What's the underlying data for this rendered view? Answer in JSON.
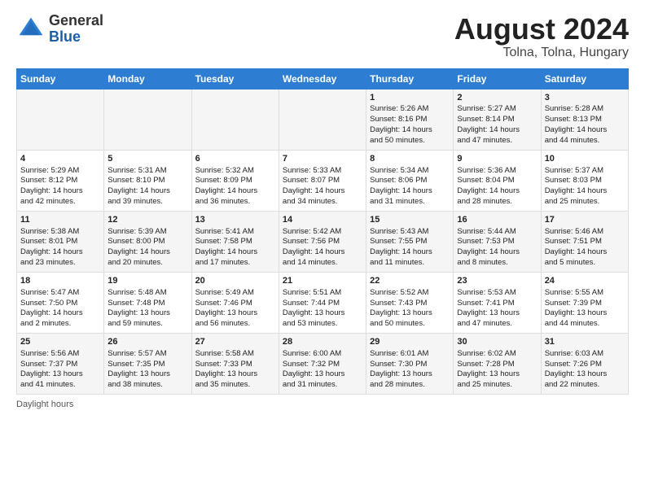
{
  "header": {
    "logo_general": "General",
    "logo_blue": "Blue",
    "title": "August 2024",
    "subtitle": "Tolna, Tolna, Hungary"
  },
  "days_of_week": [
    "Sunday",
    "Monday",
    "Tuesday",
    "Wednesday",
    "Thursday",
    "Friday",
    "Saturday"
  ],
  "footer": {
    "label": "Daylight hours"
  },
  "weeks": [
    {
      "days": [
        {
          "num": "",
          "content": ""
        },
        {
          "num": "",
          "content": ""
        },
        {
          "num": "",
          "content": ""
        },
        {
          "num": "",
          "content": ""
        },
        {
          "num": "1",
          "content": "Sunrise: 5:26 AM\nSunset: 8:16 PM\nDaylight: 14 hours\nand 50 minutes."
        },
        {
          "num": "2",
          "content": "Sunrise: 5:27 AM\nSunset: 8:14 PM\nDaylight: 14 hours\nand 47 minutes."
        },
        {
          "num": "3",
          "content": "Sunrise: 5:28 AM\nSunset: 8:13 PM\nDaylight: 14 hours\nand 44 minutes."
        }
      ]
    },
    {
      "days": [
        {
          "num": "4",
          "content": "Sunrise: 5:29 AM\nSunset: 8:12 PM\nDaylight: 14 hours\nand 42 minutes."
        },
        {
          "num": "5",
          "content": "Sunrise: 5:31 AM\nSunset: 8:10 PM\nDaylight: 14 hours\nand 39 minutes."
        },
        {
          "num": "6",
          "content": "Sunrise: 5:32 AM\nSunset: 8:09 PM\nDaylight: 14 hours\nand 36 minutes."
        },
        {
          "num": "7",
          "content": "Sunrise: 5:33 AM\nSunset: 8:07 PM\nDaylight: 14 hours\nand 34 minutes."
        },
        {
          "num": "8",
          "content": "Sunrise: 5:34 AM\nSunset: 8:06 PM\nDaylight: 14 hours\nand 31 minutes."
        },
        {
          "num": "9",
          "content": "Sunrise: 5:36 AM\nSunset: 8:04 PM\nDaylight: 14 hours\nand 28 minutes."
        },
        {
          "num": "10",
          "content": "Sunrise: 5:37 AM\nSunset: 8:03 PM\nDaylight: 14 hours\nand 25 minutes."
        }
      ]
    },
    {
      "days": [
        {
          "num": "11",
          "content": "Sunrise: 5:38 AM\nSunset: 8:01 PM\nDaylight: 14 hours\nand 23 minutes."
        },
        {
          "num": "12",
          "content": "Sunrise: 5:39 AM\nSunset: 8:00 PM\nDaylight: 14 hours\nand 20 minutes."
        },
        {
          "num": "13",
          "content": "Sunrise: 5:41 AM\nSunset: 7:58 PM\nDaylight: 14 hours\nand 17 minutes."
        },
        {
          "num": "14",
          "content": "Sunrise: 5:42 AM\nSunset: 7:56 PM\nDaylight: 14 hours\nand 14 minutes."
        },
        {
          "num": "15",
          "content": "Sunrise: 5:43 AM\nSunset: 7:55 PM\nDaylight: 14 hours\nand 11 minutes."
        },
        {
          "num": "16",
          "content": "Sunrise: 5:44 AM\nSunset: 7:53 PM\nDaylight: 14 hours\nand 8 minutes."
        },
        {
          "num": "17",
          "content": "Sunrise: 5:46 AM\nSunset: 7:51 PM\nDaylight: 14 hours\nand 5 minutes."
        }
      ]
    },
    {
      "days": [
        {
          "num": "18",
          "content": "Sunrise: 5:47 AM\nSunset: 7:50 PM\nDaylight: 14 hours\nand 2 minutes."
        },
        {
          "num": "19",
          "content": "Sunrise: 5:48 AM\nSunset: 7:48 PM\nDaylight: 13 hours\nand 59 minutes."
        },
        {
          "num": "20",
          "content": "Sunrise: 5:49 AM\nSunset: 7:46 PM\nDaylight: 13 hours\nand 56 minutes."
        },
        {
          "num": "21",
          "content": "Sunrise: 5:51 AM\nSunset: 7:44 PM\nDaylight: 13 hours\nand 53 minutes."
        },
        {
          "num": "22",
          "content": "Sunrise: 5:52 AM\nSunset: 7:43 PM\nDaylight: 13 hours\nand 50 minutes."
        },
        {
          "num": "23",
          "content": "Sunrise: 5:53 AM\nSunset: 7:41 PM\nDaylight: 13 hours\nand 47 minutes."
        },
        {
          "num": "24",
          "content": "Sunrise: 5:55 AM\nSunset: 7:39 PM\nDaylight: 13 hours\nand 44 minutes."
        }
      ]
    },
    {
      "days": [
        {
          "num": "25",
          "content": "Sunrise: 5:56 AM\nSunset: 7:37 PM\nDaylight: 13 hours\nand 41 minutes."
        },
        {
          "num": "26",
          "content": "Sunrise: 5:57 AM\nSunset: 7:35 PM\nDaylight: 13 hours\nand 38 minutes."
        },
        {
          "num": "27",
          "content": "Sunrise: 5:58 AM\nSunset: 7:33 PM\nDaylight: 13 hours\nand 35 minutes."
        },
        {
          "num": "28",
          "content": "Sunrise: 6:00 AM\nSunset: 7:32 PM\nDaylight: 13 hours\nand 31 minutes."
        },
        {
          "num": "29",
          "content": "Sunrise: 6:01 AM\nSunset: 7:30 PM\nDaylight: 13 hours\nand 28 minutes."
        },
        {
          "num": "30",
          "content": "Sunrise: 6:02 AM\nSunset: 7:28 PM\nDaylight: 13 hours\nand 25 minutes."
        },
        {
          "num": "31",
          "content": "Sunrise: 6:03 AM\nSunset: 7:26 PM\nDaylight: 13 hours\nand 22 minutes."
        }
      ]
    }
  ]
}
